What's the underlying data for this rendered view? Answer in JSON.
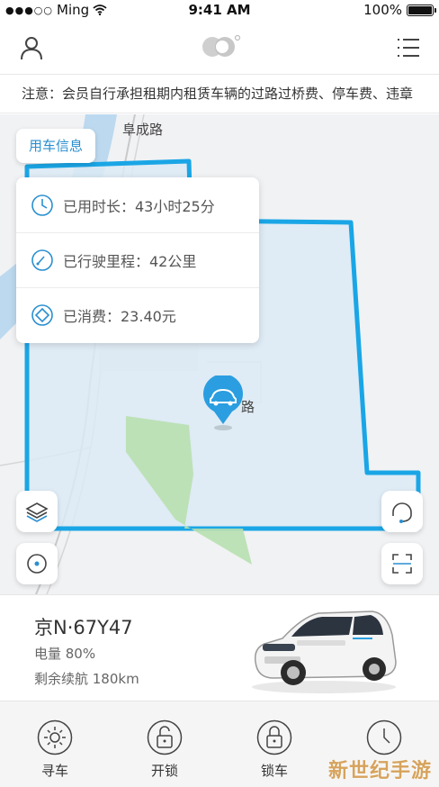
{
  "status_bar": {
    "carrier": "Ming",
    "time": "9:41 AM",
    "battery": "100%",
    "battery_level": 1.0
  },
  "header": {
    "left_icon": "user-icon",
    "logo_icon": "brand-logo-icon",
    "right_icon": "menu-icon"
  },
  "notice": {
    "text": "注意：会员自行承担租期内租赁车辆的过路过桥费、停车费、违章"
  },
  "map": {
    "road_label_top": "阜成路",
    "road_label_mid": "路",
    "info_tab_label": "用车信息",
    "info_rows": [
      {
        "icon": "clock-icon",
        "text": "已用时长：43小时25分"
      },
      {
        "icon": "speedometer-icon",
        "text": "已行驶里程：42公里"
      },
      {
        "icon": "fee-icon",
        "text": "已消费：23.40元"
      }
    ],
    "colors": {
      "zone_border": "#1aa6e6",
      "zone_fill": "#dceaf5",
      "water": "#bcd9ef",
      "park": "#b8e0b0",
      "accent": "#2a8fd0"
    }
  },
  "car": {
    "plate": "京N·67Y47",
    "battery": "电量 80%",
    "range": "剩余续航 180km"
  },
  "bottom_nav": {
    "items": [
      {
        "label": "寻车",
        "icon": "find-car-icon"
      },
      {
        "label": "开锁",
        "icon": "unlock-icon"
      },
      {
        "label": "锁车",
        "icon": "lock-icon"
      },
      {
        "label": "",
        "icon": "clock-icon"
      }
    ]
  },
  "watermark": "新世纪手游"
}
